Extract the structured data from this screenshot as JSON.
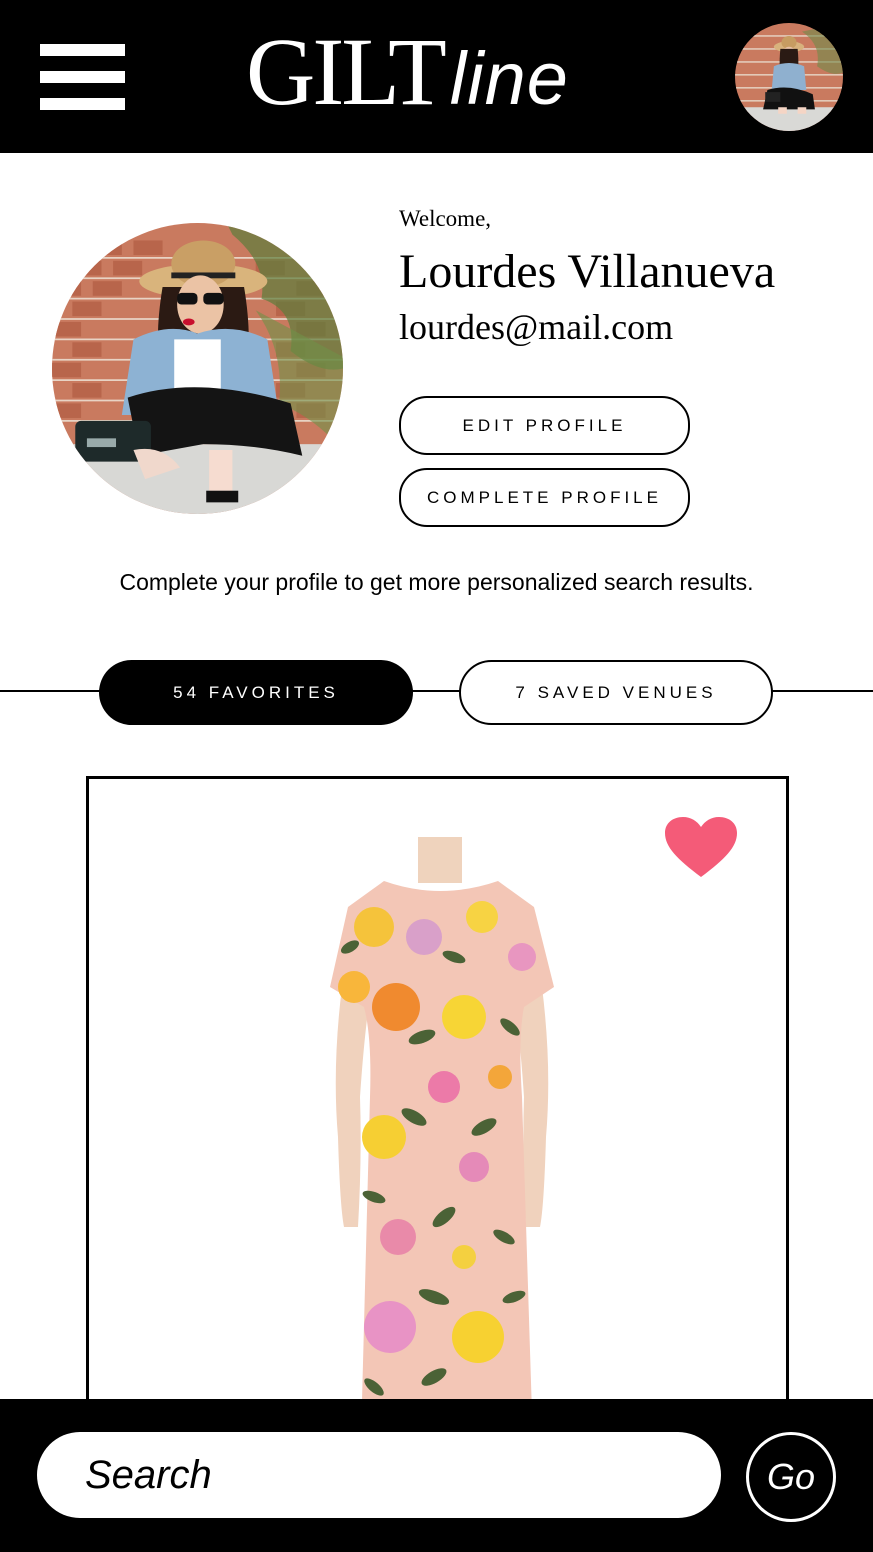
{
  "header": {
    "logo_main": "GILT",
    "logo_sub": "line",
    "menu_icon": "hamburger-menu-icon",
    "avatar_icon": "user-avatar"
  },
  "profile": {
    "welcome": "Welcome,",
    "name": "Lourdes Villanueva",
    "email": "lourdes@mail.com",
    "edit_button": "EDIT PROFILE",
    "complete_button": "COMPLETE PROFILE",
    "hint": "Complete your profile to get more personalized search results."
  },
  "tabs": [
    {
      "label": "54 FAVORITES",
      "active": true
    },
    {
      "label": "7 SAVED VENUES",
      "active": false
    }
  ],
  "favorites": {
    "items": [
      {
        "image": "floral-print-dress",
        "favorited": true,
        "heart_color": "#f45b78"
      }
    ]
  },
  "search": {
    "placeholder": "Search",
    "go_label": "Go"
  },
  "colors": {
    "primary": "#000000",
    "background": "#ffffff",
    "accent": "#f45b78"
  }
}
